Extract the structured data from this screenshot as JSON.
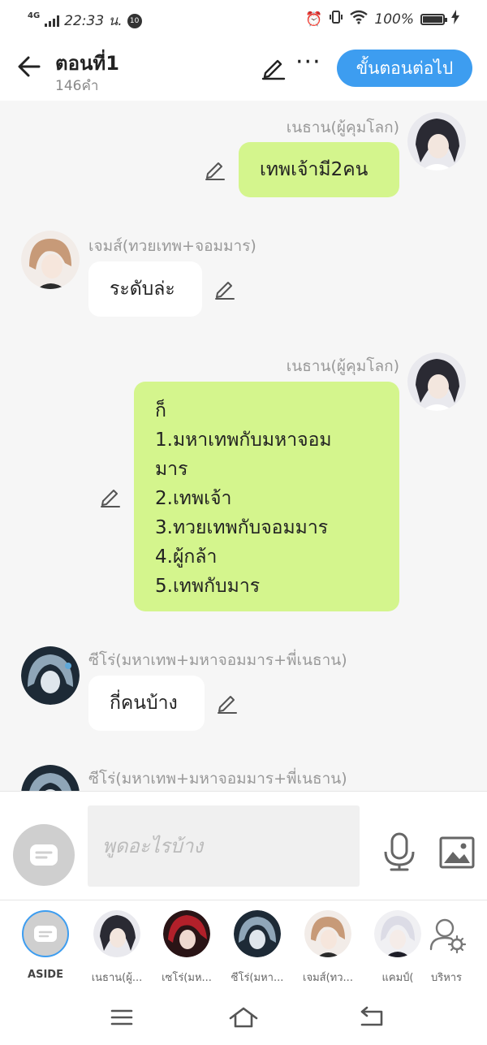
{
  "status_bar": {
    "network": "4G",
    "time": "22:33 น.",
    "notification": "10",
    "battery": "100%",
    "icons": [
      "alarm-icon",
      "vibrate-icon",
      "wifi-icon",
      "battery-icon",
      "charging-icon"
    ]
  },
  "header": {
    "title": "ตอนที่1",
    "word_count": "146คำ",
    "more_label": "···",
    "next_button": "ขั้นตอนต่อไป"
  },
  "messages": [
    {
      "sender": "เนธาน(ผู้คุมโลก)",
      "side": "right",
      "lines": [
        "เทพเจ้ามี2คน"
      ]
    },
    {
      "sender": "เจมส์(ทวยเทพ+จอมมาร)",
      "side": "left",
      "lines": [
        "ระดับล่ะ"
      ]
    },
    {
      "sender": "เนธาน(ผู้คุมโลก)",
      "side": "right",
      "lines": [
        "ก็",
        "1.มหาเทพกับมหาจอม",
        "มาร",
        "2.เทพเจ้า",
        "3.ทวยเทพกับจอมมาร",
        "4.ผู้กล้า",
        "5.เทพกับมาร"
      ]
    },
    {
      "sender": "ซีโร่(มหาเทพ+มหาจอมมาร+พี่เนธาน)",
      "side": "left",
      "lines": [
        "กี่คนบ้าง"
      ]
    },
    {
      "sender": "ซีโร่(มหาเทพ+มหาจอมมาร+พี่เนธาน)",
      "side": "left",
      "lines": []
    }
  ],
  "input": {
    "placeholder": "พูดอะไรบ้าง"
  },
  "characters": [
    {
      "label": "ASIDE"
    },
    {
      "label": "เนธาน(ผู้..."
    },
    {
      "label": "เซโร่(มห..."
    },
    {
      "label": "ซีโร่(มหา..."
    },
    {
      "label": "เจมส์(ทว..."
    },
    {
      "label": "แคมป์("
    },
    {
      "label": "บริหาร"
    }
  ],
  "colors": {
    "accent": "#3d9df0",
    "my_bubble": "#d4f58d",
    "other_bubble": "#ffffff",
    "background": "#f6f6f6"
  }
}
